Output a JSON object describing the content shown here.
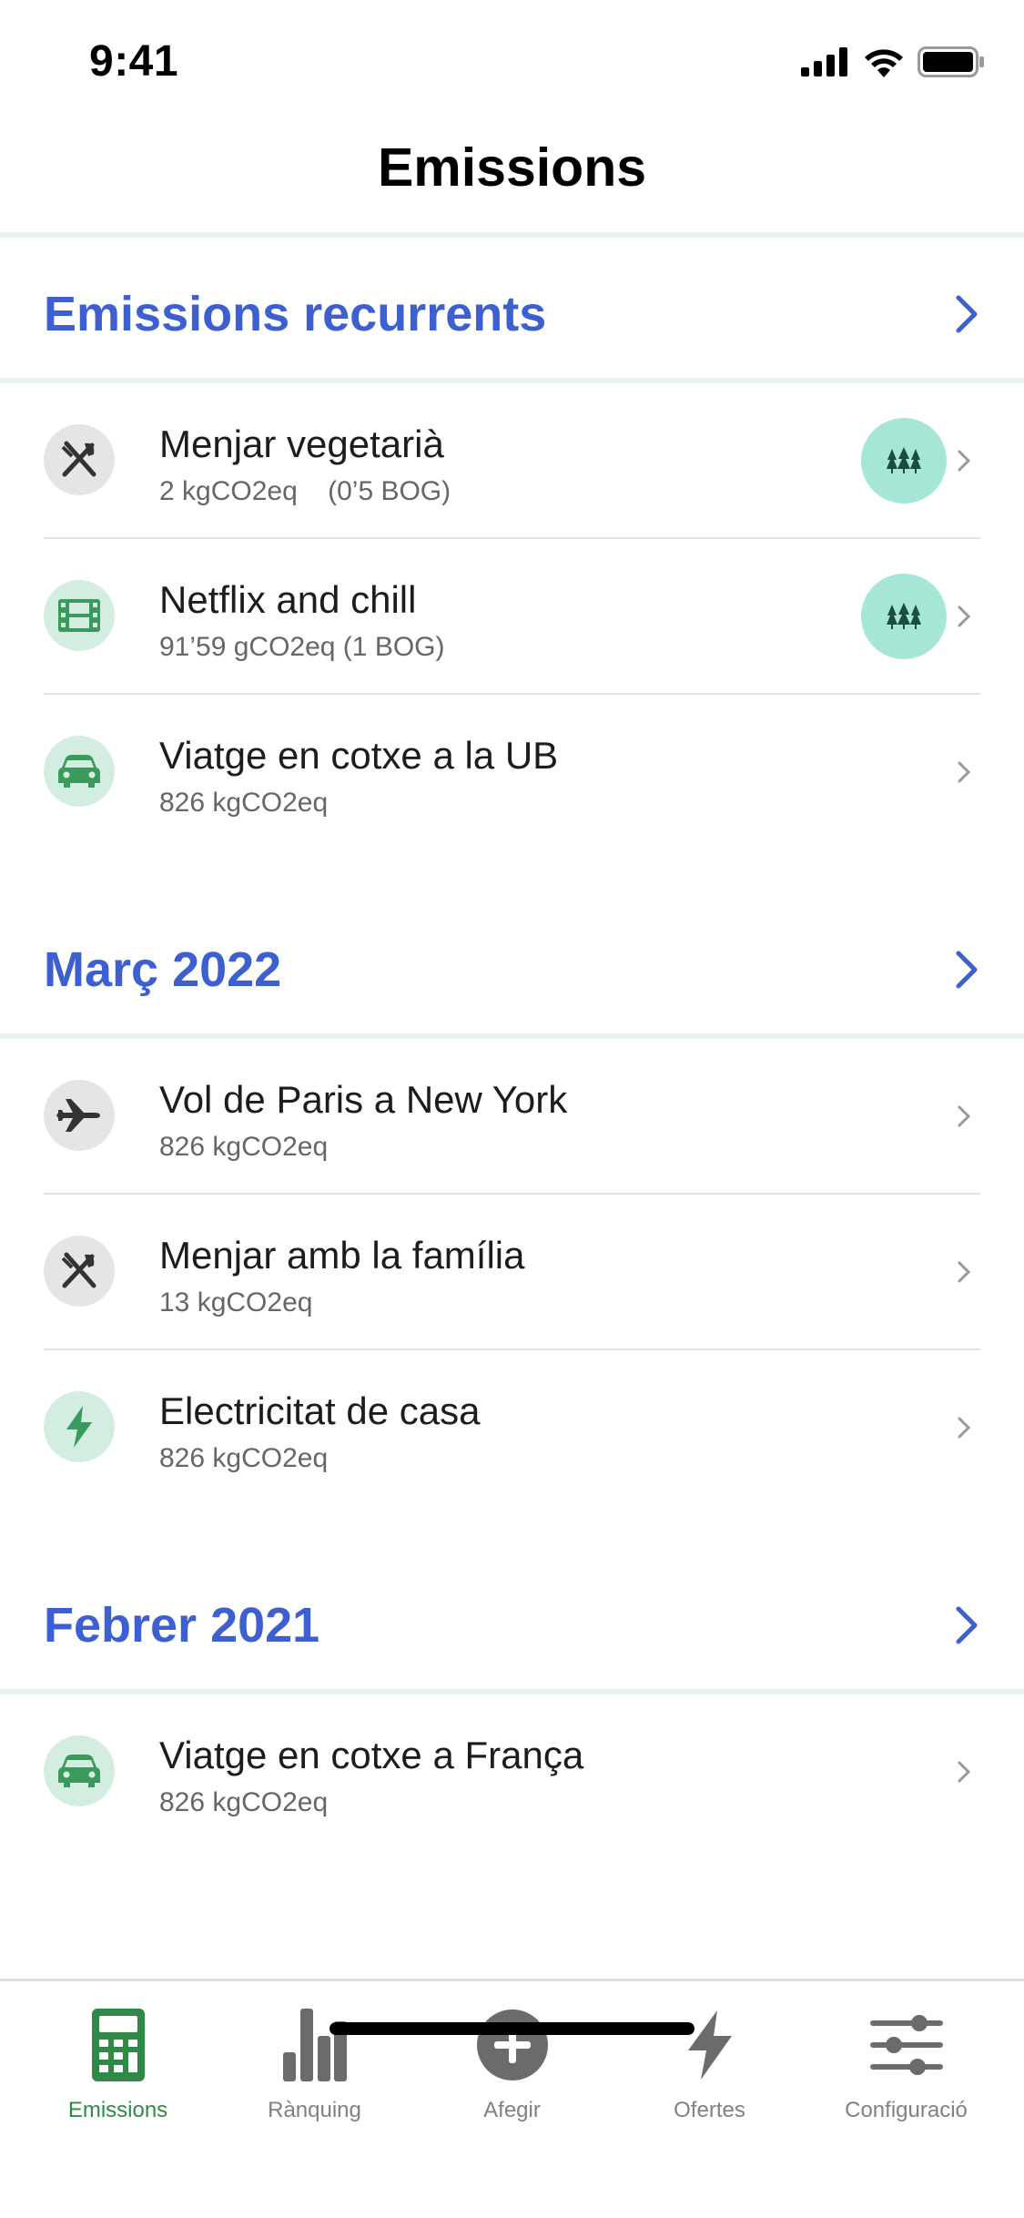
{
  "status_bar": {
    "time": "9:41"
  },
  "nav": {
    "title": "Emissions"
  },
  "sections": [
    {
      "title": "Emissions recurrents",
      "items": [
        {
          "icon": "fork-knife-icon",
          "title": "Menjar vegetarià",
          "subtitle": "2 kgCO2eq    (0’5 BOG)",
          "badge": "trees-icon"
        },
        {
          "icon": "film-icon",
          "title": "Netflix and chill",
          "subtitle": "91’59 gCO2eq (1 BOG)",
          "badge": "trees-icon"
        },
        {
          "icon": "car-icon",
          "title": "Viatge en cotxe a la UB",
          "subtitle": "826 kgCO2eq"
        }
      ]
    },
    {
      "title": "Març 2022",
      "items": [
        {
          "icon": "airplane-icon",
          "title": "Vol de Paris a New York",
          "subtitle": "826 kgCO2eq"
        },
        {
          "icon": "fork-knife-icon",
          "title": "Menjar amb la família",
          "subtitle": "13 kgCO2eq"
        },
        {
          "icon": "lightning-icon",
          "title": "Electricitat de casa",
          "subtitle": "826 kgCO2eq"
        }
      ]
    },
    {
      "title": "Febrer 2021",
      "items": [
        {
          "icon": "car-icon",
          "title": "Viatge en cotxe a França",
          "subtitle": "826 kgCO2eq"
        }
      ]
    }
  ],
  "tab_bar": {
    "tabs": [
      {
        "label": "Emissions",
        "icon": "calculator-icon",
        "active": true
      },
      {
        "label": "Rànquing",
        "icon": "bar-chart-icon",
        "active": false
      },
      {
        "label": "Afegir",
        "icon": "plus-circle-icon",
        "active": false
      },
      {
        "label": "Ofertes",
        "icon": "lightning-icon",
        "active": false
      },
      {
        "label": "Configuració",
        "icon": "sliders-icon",
        "active": false
      }
    ]
  },
  "colors": {
    "accent_blue": "#3d5fcf",
    "active_green": "#2f8a47",
    "badge_teal": "#a6e6d6"
  }
}
